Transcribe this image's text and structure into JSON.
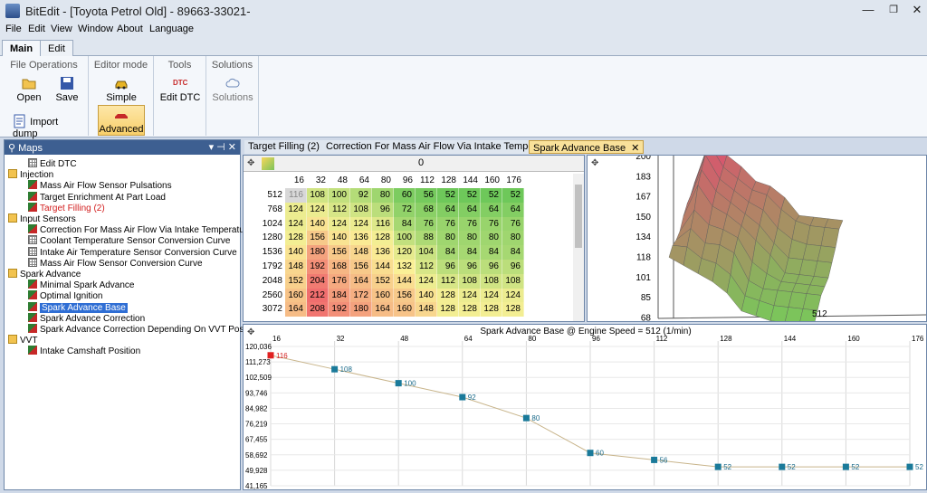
{
  "title": "BitEdit - [Toyota Petrol Old] - 89663-33021-",
  "window_buttons": {
    "minimize": "—",
    "restore": "❐",
    "close": "✕"
  },
  "menu": [
    "File",
    "Edit",
    "View",
    "Window",
    "About",
    "Language"
  ],
  "ribbon_tabs": [
    "Main",
    "Edit"
  ],
  "ribbon": {
    "file_operations": {
      "label": "File Operations",
      "open": "Open",
      "save": "Save",
      "import_dump": "Import dump"
    },
    "editor_mode": {
      "label": "Editor mode",
      "simple": "Simple",
      "advanced": "Advanced"
    },
    "tools": {
      "label": "Tools",
      "edit_dtc": "Edit DTC",
      "dtc_icon": "DTC"
    },
    "solutions": {
      "label": "Solutions",
      "solutions": "Solutions"
    }
  },
  "maps_panel": {
    "title": "Maps",
    "pin": "▾ ⊣ ✕"
  },
  "tree": [
    {
      "label": "Edit DTC",
      "icon": "dtc-icon",
      "level": 1
    },
    {
      "label": "Injection",
      "icon": "folder-icon",
      "level": 0
    },
    {
      "label": "Mass Air Flow Sensor Pulsations",
      "icon": "chart-icon",
      "level": 1
    },
    {
      "label": "Target Enrichment At Part Load",
      "icon": "chart-icon",
      "level": 1
    },
    {
      "label": "Target Filling (2)",
      "icon": "chart-icon",
      "level": 1,
      "red": true
    },
    {
      "label": "Input Sensors",
      "icon": "folder-icon",
      "level": 0
    },
    {
      "label": "Correction For Mass Air Flow Via Intake Temperature",
      "icon": "chart-icon",
      "level": 1
    },
    {
      "label": "Coolant Temperature Sensor Conversion Curve",
      "icon": "grid-icon",
      "level": 1
    },
    {
      "label": "Intake Air Temperature Sensor Conversion Curve",
      "icon": "grid-icon",
      "level": 1
    },
    {
      "label": "Mass Air Flow Sensor Conversion Curve",
      "icon": "grid-icon",
      "level": 1
    },
    {
      "label": "Spark Advance",
      "icon": "folder-icon",
      "level": 0
    },
    {
      "label": "Minimal Spark Advance",
      "icon": "chart-icon",
      "level": 1
    },
    {
      "label": "Optimal Ignition",
      "icon": "chart-icon",
      "level": 1
    },
    {
      "label": "Spark Advance Base",
      "icon": "chart-icon",
      "level": 1,
      "selected": true
    },
    {
      "label": "Spark Advance Correction",
      "icon": "chart-icon",
      "level": 1
    },
    {
      "label": "Spark Advance Correction Depending On VVT Position",
      "icon": "chart-icon",
      "level": 1
    },
    {
      "label": "VVT",
      "icon": "folder-icon",
      "level": 0
    },
    {
      "label": "Intake Camshaft Position",
      "icon": "chart-icon",
      "level": 1
    }
  ],
  "doc_tabs": [
    "Target Filling (2)",
    "Correction For Mass Air Flow Via Intake Temperature",
    "Spark Advance Base"
  ],
  "doc_tab_close": "✕",
  "table": {
    "x_axis_label": "0",
    "y_axis_label": "0",
    "columns": [
      "16",
      "32",
      "48",
      "64",
      "80",
      "96",
      "112",
      "128",
      "144",
      "160",
      "176"
    ],
    "rows": [
      {
        "label": "512",
        "values": [
          116,
          108,
          100,
          92,
          80,
          60,
          56,
          52,
          52,
          52,
          52
        ]
      },
      {
        "label": "768",
        "values": [
          124,
          124,
          112,
          108,
          96,
          72,
          68,
          64,
          64,
          64,
          64
        ]
      },
      {
        "label": "1024",
        "values": [
          124,
          140,
          124,
          124,
          116,
          84,
          76,
          76,
          76,
          76,
          76
        ]
      },
      {
        "label": "1280",
        "values": [
          128,
          156,
          140,
          136,
          128,
          100,
          88,
          80,
          80,
          80,
          80
        ]
      },
      {
        "label": "1536",
        "values": [
          140,
          180,
          156,
          148,
          136,
          120,
          104,
          84,
          84,
          84,
          84
        ]
      },
      {
        "label": "1792",
        "values": [
          148,
          192,
          168,
          156,
          144,
          132,
          112,
          96,
          96,
          96,
          96
        ]
      },
      {
        "label": "2048",
        "values": [
          152,
          204,
          176,
          164,
          152,
          144,
          124,
          112,
          108,
          108,
          108
        ]
      },
      {
        "label": "2560",
        "values": [
          160,
          212,
          184,
          172,
          160,
          156,
          140,
          128,
          124,
          124,
          124
        ]
      },
      {
        "label": "3072",
        "values": [
          164,
          208,
          192,
          180,
          164,
          160,
          148,
          128,
          128,
          128,
          128
        ]
      }
    ]
  },
  "surface": {
    "z_ticks": [
      "200",
      "183",
      "167",
      "150",
      "134",
      "118",
      "101",
      "85",
      "68"
    ],
    "x_label": "512"
  },
  "chart_data": {
    "type": "line",
    "title": "Spark Advance Base @ Engine Speed = 512 (1/min)",
    "x": [
      16,
      32,
      48,
      64,
      80,
      96,
      112,
      128,
      144,
      160,
      176
    ],
    "series": [
      {
        "values": [
          116,
          108,
          100,
          92,
          80,
          60,
          56,
          52,
          52,
          52,
          52
        ]
      }
    ],
    "y_ticks": [
      "120,036",
      "111,273",
      "102,509",
      "93,746",
      "84,982",
      "76,219",
      "67,455",
      "58,692",
      "49,928",
      "41,165"
    ],
    "ylim": [
      41.165,
      120.036
    ],
    "xlim": [
      16,
      176
    ],
    "grid": true,
    "colors": {
      "point": "#1a7a9a",
      "selected": "#e02020",
      "line": "#c8b48a"
    }
  }
}
